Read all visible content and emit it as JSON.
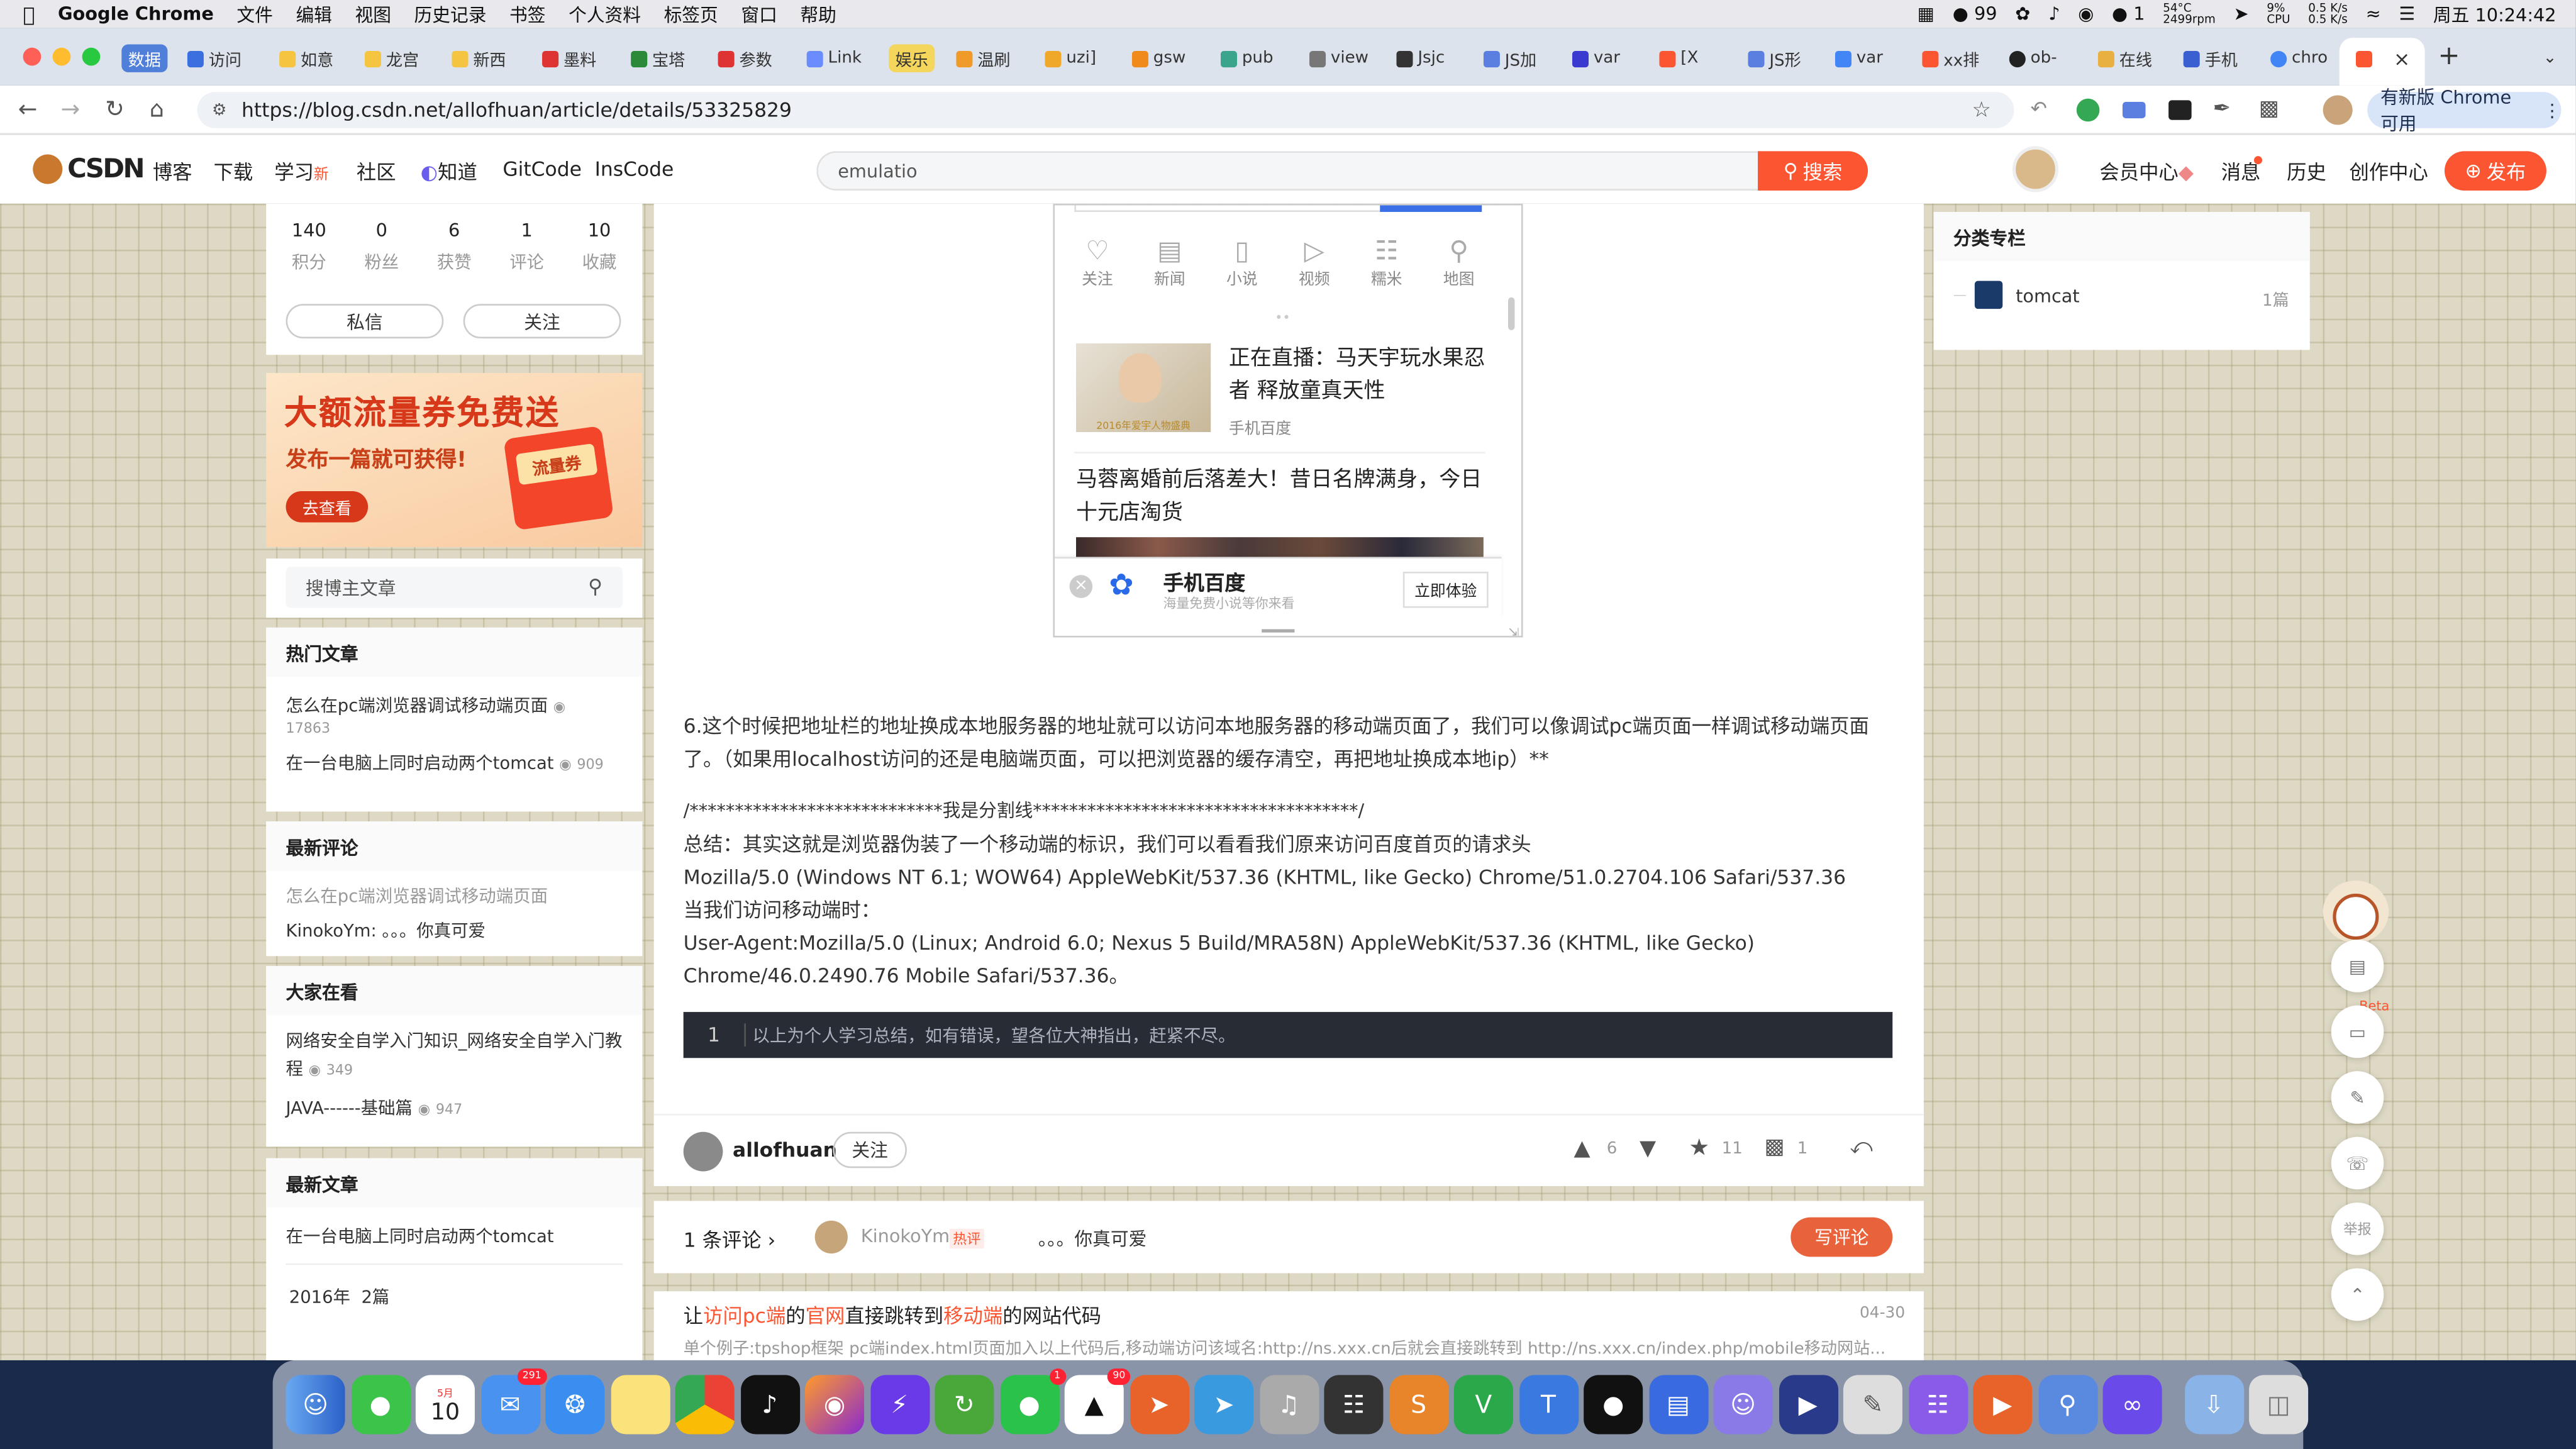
{
  "menubar": {
    "app_name": "Google Chrome",
    "items": [
      "文件",
      "编辑",
      "视图",
      "历史记录",
      "书签",
      "个人资料",
      "标签页",
      "窗口",
      "帮助"
    ],
    "notify_count": "99",
    "wechat_count": "1",
    "temp": "54°C",
    "rpm": "2499rpm",
    "cpu": "9%",
    "cpu_label": "CPU",
    "net_up": "0.5 K/s",
    "net_down": "0.5 K/s",
    "clock": "周五 10:24:42"
  },
  "tabs": [
    {
      "label": "数据",
      "chip": "blue"
    },
    {
      "label": "访问"
    },
    {
      "label": "如意"
    },
    {
      "label": "龙宫"
    },
    {
      "label": "新西"
    },
    {
      "label": "墨料"
    },
    {
      "label": "宝塔"
    },
    {
      "label": "参数"
    },
    {
      "label": "Link"
    },
    {
      "label": "娱乐",
      "chip": "yellow"
    },
    {
      "label": "温刷"
    },
    {
      "label": "uzi]"
    },
    {
      "label": "gsw"
    },
    {
      "label": "pub"
    },
    {
      "label": "view"
    },
    {
      "label": "Jsjc"
    },
    {
      "label": "JS加"
    },
    {
      "label": "var"
    },
    {
      "label": "[X"
    },
    {
      "label": "JS形"
    },
    {
      "label": "var"
    },
    {
      "label": "xx排"
    },
    {
      "label": "ob-"
    },
    {
      "label": "在线"
    },
    {
      "label": "手机"
    },
    {
      "label": "chro"
    }
  ],
  "tab_add": "+",
  "address": {
    "url": "https://blog.csdn.net/allofhuan/article/details/53325829",
    "update_label": "有新版 Chrome 可用",
    "menu_label": "⋮"
  },
  "csdn": {
    "logo": "CSDN",
    "nav": [
      "博客",
      "下载",
      "学习",
      "社区",
      "知道",
      "GitCode",
      "InsCode"
    ],
    "nav_new": "新",
    "search_value": "emulatio",
    "search_button": "搜索",
    "right_nav": [
      "会员中心",
      "消息",
      "历史",
      "创作中心"
    ],
    "publish": "发布"
  },
  "profile": {
    "stats": [
      {
        "value": "140",
        "label": "积分"
      },
      {
        "value": "0",
        "label": "粉丝"
      },
      {
        "value": "6",
        "label": "获赞"
      },
      {
        "value": "1",
        "label": "评论"
      },
      {
        "value": "10",
        "label": "收藏"
      }
    ],
    "message_btn": "私信",
    "follow_btn": "关注"
  },
  "banner": {
    "title": "大额流量券免费送",
    "subtitle": "发布一篇就可获得!",
    "cta": "去查看",
    "coupon": "流量券"
  },
  "blog_search": {
    "placeholder": "搜博主文章"
  },
  "hot": {
    "title": "热门文章",
    "items": [
      {
        "title": "怎么在pc端浏览器调试移动端页面",
        "views": "17863"
      },
      {
        "title": "在一台电脑上同时启动两个tomcat",
        "views": "909"
      }
    ]
  },
  "comments": {
    "title": "最新评论",
    "article": "怎么在pc端浏览器调试移动端页面",
    "comment": "KinokoYm: 。。。你真可爱"
  },
  "watching": {
    "title": "大家在看",
    "items": [
      {
        "title": "网络安全自学入门知识_网络安全自学入门教程",
        "views": "349"
      },
      {
        "title": "JAVA------基础篇",
        "views": "947"
      }
    ]
  },
  "latest": {
    "title": "最新文章",
    "items": [
      "在一台电脑上同时启动两个tomcat"
    ],
    "archive_year": "2016年",
    "archive_count": "2篇"
  },
  "category": {
    "title": "分类专栏",
    "items": [
      {
        "name": "tomcat",
        "count": "1篇"
      }
    ]
  },
  "phone": {
    "icons": [
      "关注",
      "新闻",
      "小说",
      "视频",
      "糯米",
      "地图"
    ],
    "news1_title": "正在直播：马天宇玩水果忍者 释放童真天性",
    "news1_source": "手机百度",
    "news1_thumb": "2016年爱宇人物盛典",
    "news2_title": "马蓉离婚前后落差大！昔日名牌满身，今日十元店淘货",
    "app_name": "手机百度",
    "app_sub": "海量免费小说等你来看",
    "app_btn": "立即体验"
  },
  "article": {
    "p1": "6.这个时候把地址栏的地址换成本地服务器的地址就可以访问本地服务器的移动端页面了，我们可以像调试pc端页面一样调试移动端页面了。（如果用localhost访问的还是电脑端页面，可以把浏览器的缓存清空，再把地址换成本地ip）**",
    "divider": "/****************************我是分割线************************************/",
    "summary": "总结：其实这就是浏览器伪装了一个移动端的标识，我们可以看看我们原来访问百度首页的请求头",
    "ua_pc": "Mozilla/5.0 (Windows NT 6.1; WOW64) AppleWebKit/537.36 (KHTML, like Gecko) Chrome/51.0.2704.106 Safari/537.36",
    "mobile_intro": "当我们访问移动端时：",
    "ua_mobile": "User-Agent:Mozilla/5.0 (Linux; Android 6.0; Nexus 5 Build/MRA58N) AppleWebKit/537.36 (KHTML, like Gecko) Chrome/46.0.2490.76 Mobile Safari/537.36。",
    "code_line_no": "1",
    "code_line": "以上为个人学习总结，如有错误，望各位大神指出，赶紧不尽。"
  },
  "author_bar": {
    "name": "allofhuan",
    "follow": "关注",
    "likes": "6",
    "stars": "11",
    "comments": "1"
  },
  "comment_bar": {
    "count_label": "1 条评论",
    "user": "KinokoYm",
    "tag": "热评",
    "text": "。。。你真可爱",
    "write": "写评论"
  },
  "related": {
    "parts": [
      {
        "t": "让",
        "hl": false
      },
      {
        "t": "访问pc端",
        "hl": true
      },
      {
        "t": "的",
        "hl": false
      },
      {
        "t": "官网",
        "hl": true
      },
      {
        "t": "直接跳转到",
        "hl": false
      },
      {
        "t": "移动端",
        "hl": true
      },
      {
        "t": "的网站代码",
        "hl": false
      }
    ],
    "date": "04-30",
    "snippet": "单个例子:tpshop框架 pc端index.html页面加入以上代码后,移动端访问该域名:http://ns.xxx.cn后就会直接跳转到 http://ns.xxx.cn/index.php/mobile移动网站..."
  },
  "right_tools": {
    "beta": "Beta",
    "report": "举报"
  },
  "dock": {
    "calendar_month": "5月",
    "calendar_day": "10",
    "mail_badge": "291",
    "wechat_badge": "1",
    "qq_badge": "90"
  }
}
